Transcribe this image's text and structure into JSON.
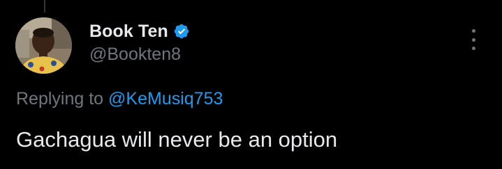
{
  "author": {
    "display_name": "Book Ten",
    "handle": "@Bookten8",
    "verified": true,
    "avatar_icon": "profile-photo"
  },
  "reply": {
    "prefix": "Replying to",
    "target_handle": "@KeMusiq753"
  },
  "tweet": {
    "text": "Gachagua will never be an option"
  },
  "menu": {
    "icon": "more-vertical-icon"
  },
  "colors": {
    "background": "#000000",
    "primary_text": "#e7e9ea",
    "secondary_text": "#71767b",
    "accent": "#1d9bf0"
  }
}
